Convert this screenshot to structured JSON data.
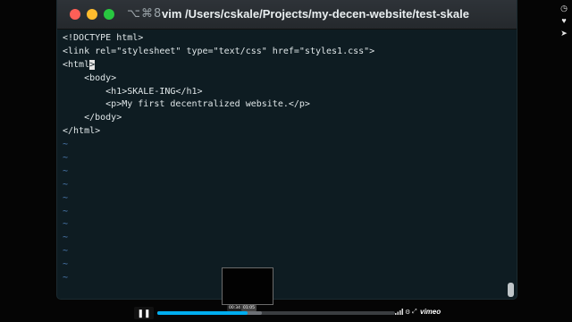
{
  "window": {
    "shortcut": "⌥⌘8",
    "title": "vim /Users/cskale/Projects/my-decen-website/test-skale"
  },
  "editor": {
    "lines": [
      "<!DOCTYPE html>",
      "<link rel=\"stylesheet\" type=\"text/css\" href=\"styles1.css\">",
      "<html>",
      "    <body>",
      "        <h1>SKALE-ING</h1>",
      "        <p>My first decentralized website.</p>",
      "    </body>",
      "</html>"
    ],
    "cursor_line_prefix": "<html",
    "cursor_char": ">",
    "tilde": "~"
  },
  "player": {
    "progress_fraction": 0.38,
    "buffer_fraction": 0.44,
    "time_current": "00:34",
    "time_hover": "01:05",
    "logo": "vimeo",
    "colors": {
      "accent": "#00adef",
      "close": "#ff5f57",
      "minimize": "#febc2e",
      "maximize": "#28c840"
    }
  },
  "icons": {
    "side": [
      "clock-icon",
      "heart-icon",
      "send-icon"
    ],
    "controls": [
      "pause-icon",
      "volume-icon",
      "settings-icon",
      "fullscreen-icon"
    ]
  }
}
